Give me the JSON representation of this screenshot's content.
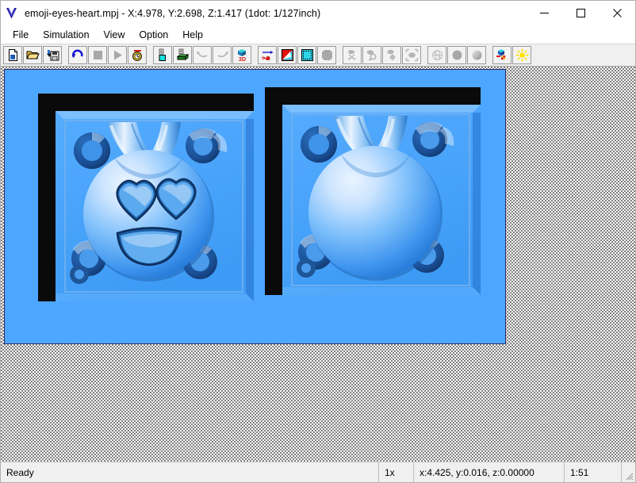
{
  "window": {
    "app_icon": "v-logo-icon",
    "title": "emoji-eyes-heart.mpj - X:4.978, Y:2.698, Z:1.417 (1dot: 1/127inch)",
    "minimize_label": "Minimize",
    "maximize_label": "Maximize",
    "close_label": "Close"
  },
  "menubar": {
    "items": [
      {
        "label": "File"
      },
      {
        "label": "Simulation"
      },
      {
        "label": "View"
      },
      {
        "label": "Option"
      },
      {
        "label": "Help"
      }
    ]
  },
  "toolbar": {
    "groups": [
      {
        "buttons": [
          {
            "icon": "new-document-icon",
            "label": "New",
            "enabled": true,
            "framed": true
          },
          {
            "icon": "open-folder-icon",
            "label": "Open",
            "enabled": true,
            "framed": true
          },
          {
            "icon": "save-disk-icon",
            "label": "Save",
            "enabled": true,
            "framed": true
          }
        ]
      },
      {
        "buttons": [
          {
            "icon": "reload-arrow-icon",
            "label": "Reload",
            "enabled": true,
            "framed": true
          },
          {
            "icon": "stop-square-icon",
            "label": "Stop",
            "enabled": false,
            "framed": true
          },
          {
            "icon": "play-triangle-icon",
            "label": "Play",
            "enabled": false,
            "framed": true
          },
          {
            "icon": "stopwatch-icon",
            "label": "Speed",
            "enabled": true,
            "framed": true
          }
        ]
      },
      {
        "buttons": [
          {
            "icon": "stock-cyan-block-icon",
            "label": "Stock View",
            "enabled": true,
            "framed": true
          },
          {
            "icon": "stock-green-block-icon",
            "label": "Material View",
            "enabled": true,
            "framed": true
          },
          {
            "icon": "undo-arrow-icon",
            "label": "Undo",
            "enabled": false,
            "framed": true
          },
          {
            "icon": "redo-arrow-icon",
            "label": "Redo",
            "enabled": false,
            "framed": true
          },
          {
            "icon": "three-d-icon",
            "label": "3D",
            "enabled": true,
            "framed": true
          }
        ]
      },
      {
        "buttons": [
          {
            "icon": "toolpath-arrow-icon",
            "label": "Toolpath",
            "enabled": true,
            "framed": true
          },
          {
            "icon": "red-cyan-gradient-icon",
            "label": "Depth Color",
            "enabled": true,
            "framed": true
          },
          {
            "icon": "selection-rect-icon",
            "label": "Select Region",
            "enabled": true,
            "framed": true
          },
          {
            "icon": "gray-polygon-icon",
            "label": "Shape",
            "enabled": true,
            "framed": true
          }
        ]
      },
      {
        "buttons": [
          {
            "icon": "rotate-view-icon",
            "label": "Rotate",
            "enabled": false,
            "framed": true
          },
          {
            "icon": "zoom-view-icon",
            "label": "Zoom",
            "enabled": false,
            "framed": true
          },
          {
            "icon": "pan-view-icon",
            "label": "Pan",
            "enabled": false,
            "framed": true
          },
          {
            "icon": "fit-view-icon",
            "label": "Fit",
            "enabled": false,
            "framed": true
          }
        ]
      },
      {
        "buttons": [
          {
            "icon": "wireframe-globe-icon",
            "label": "Wireframe",
            "enabled": false,
            "framed": true
          },
          {
            "icon": "flat-shading-icon",
            "label": "Flat Shading",
            "enabled": true,
            "framed": true
          },
          {
            "icon": "smooth-shading-icon",
            "label": "Smooth Shading",
            "enabled": true,
            "framed": true
          }
        ]
      },
      {
        "buttons": [
          {
            "icon": "material-texture-icon",
            "label": "Material",
            "enabled": true,
            "framed": true
          },
          {
            "icon": "light-sun-icon",
            "label": "Light",
            "enabled": true,
            "framed": true
          }
        ]
      }
    ]
  },
  "viewport": {
    "name": "simulation-3d-view",
    "background_color": "#4da6ff",
    "border_color": "#2b2b6b",
    "panels": [
      {
        "name": "carving-preview-left",
        "description": "Heart-eyes emoji relief carved in a square frame with four corner posts"
      },
      {
        "name": "carving-preview-right",
        "description": "Blank sphere relief carved in a square frame with four corner posts"
      }
    ]
  },
  "statusbar": {
    "message": "Ready",
    "zoom": "1x",
    "coordinates": "x:4.425, y:0.016, z:0.00000",
    "ratio": "1:51"
  }
}
